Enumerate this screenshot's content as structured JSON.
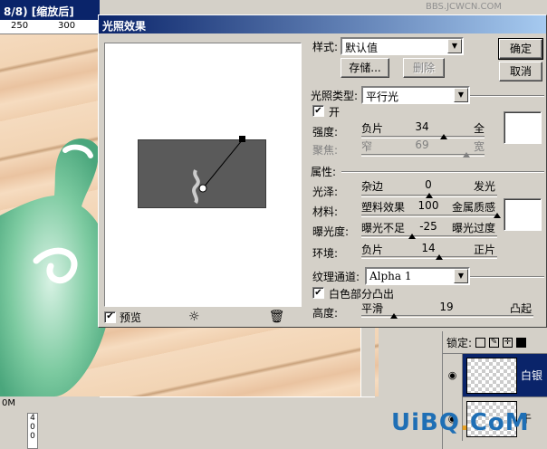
{
  "background_doc": {
    "title_fragment": "8/8) [缩放后]",
    "ruler_ticks": [
      "250",
      "300"
    ],
    "zoom_fragment": "0M",
    "ruler2_ticks": [
      "4",
      "0",
      "0"
    ]
  },
  "watermark": {
    "site_text": "BBS.JCWCN.COM",
    "brand_main": "UiBQ",
    "brand_dot": ".",
    "brand_tail": "CoM"
  },
  "dialog": {
    "title": "光照效果",
    "preview": {
      "checkbox_label": "预览",
      "checked": true,
      "bulb_icon": "light-bulb-icon",
      "trash_icon": "trash-icon"
    },
    "style": {
      "label": "样式:",
      "value": "默认值",
      "save_button": "存储...",
      "delete_button": "删除"
    },
    "buttons": {
      "ok": "确定",
      "cancel": "取消"
    },
    "light_type": {
      "label": "光照类型:",
      "value": "平行光",
      "on_label": "开",
      "on_checked": true,
      "intensity": {
        "label": "强度:",
        "left": "负片",
        "value": "34",
        "right": "全",
        "fraction": 0.67
      },
      "focus": {
        "label": "聚焦:",
        "left": "窄",
        "value": "69",
        "right": "宽",
        "fraction": 0.85,
        "disabled": true
      },
      "color": "#ffffff"
    },
    "properties": {
      "label": "属性:",
      "gloss": {
        "label": "光泽:",
        "left": "杂边",
        "value": "0",
        "right": "发光",
        "fraction": 0.5
      },
      "material": {
        "label": "材料:",
        "left": "塑料效果",
        "value": "100",
        "right": "金属质感",
        "fraction": 1.0
      },
      "exposure": {
        "label": "曝光度:",
        "left": "曝光不足",
        "value": "-25",
        "right": "曝光过度",
        "fraction": 0.375
      },
      "ambience": {
        "label": "环境:",
        "left": "负片",
        "value": "14",
        "right": "正片",
        "fraction": 0.57
      },
      "color": "#ffffff"
    },
    "texture": {
      "label": "纹理通道:",
      "value": "Alpha 1",
      "white_high_label": "白色部分凸出",
      "white_high_checked": true,
      "height": {
        "label": "高度:",
        "left": "平滑",
        "value": "19",
        "right": "凸起",
        "fraction": 0.19
      }
    }
  },
  "layers": {
    "lock_label": "锁定:",
    "items": [
      {
        "name": "白银",
        "selected": true
      },
      {
        "name": "于",
        "selected": false
      }
    ]
  }
}
